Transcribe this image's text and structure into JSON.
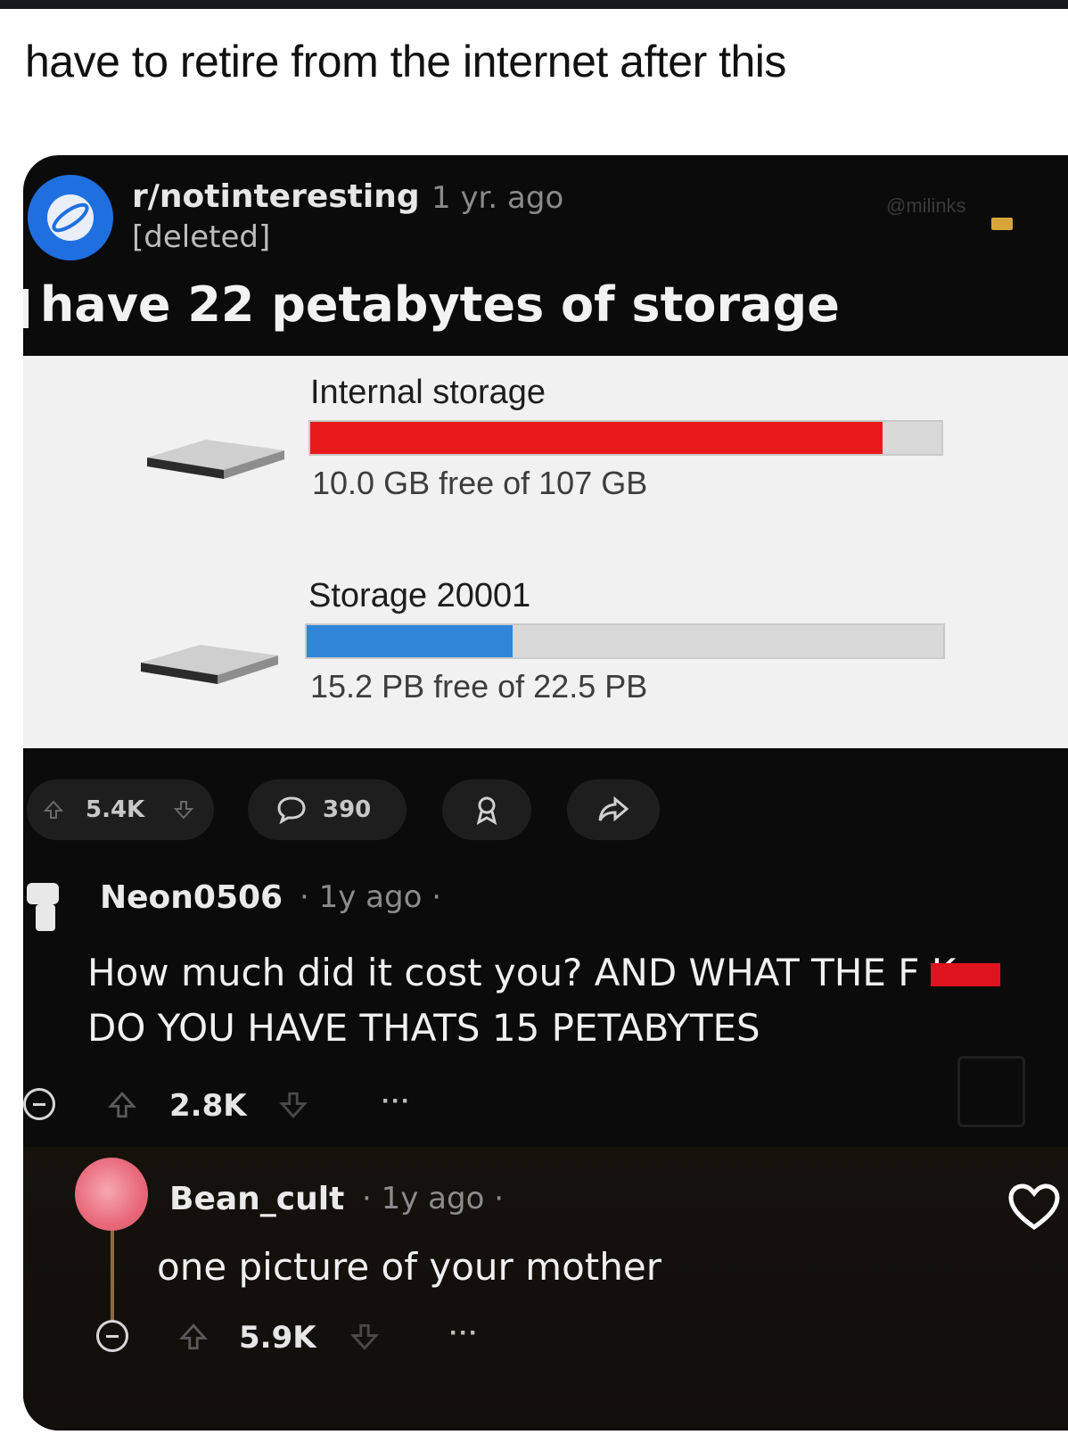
{
  "caption": "have to retire from the internet after this",
  "post": {
    "subreddit": "r/notinteresting",
    "time": "1 yr. ago",
    "author": "[deleted]",
    "watermark": "@milinks",
    "title": "have 22 petabytes of storage",
    "upvotes": "5.4K",
    "comments": "390"
  },
  "storage": {
    "drives": [
      {
        "label": "Internal storage",
        "detail": "10.0 GB free of 107 GB",
        "used_fraction": 0.907,
        "bar_color": "#e81b1b"
      },
      {
        "label": "Storage 20001",
        "detail": "15.2 PB free of 22.5 PB",
        "used_fraction": 0.324,
        "bar_color": "#2f86d6"
      }
    ]
  },
  "comments": [
    {
      "user": "Neon0506",
      "meta": "· 1y ago ·",
      "line1": "How much did it cost you? AND WHAT THE F    K",
      "line2": "DO YOU HAVE THATS 15 PETABYTES",
      "votes": "2.8K",
      "more": "···"
    },
    {
      "user": "Bean_cult",
      "meta": "· 1y ago ·",
      "line1": "one picture of your mother",
      "votes": "5.9K",
      "more": "···"
    }
  ]
}
